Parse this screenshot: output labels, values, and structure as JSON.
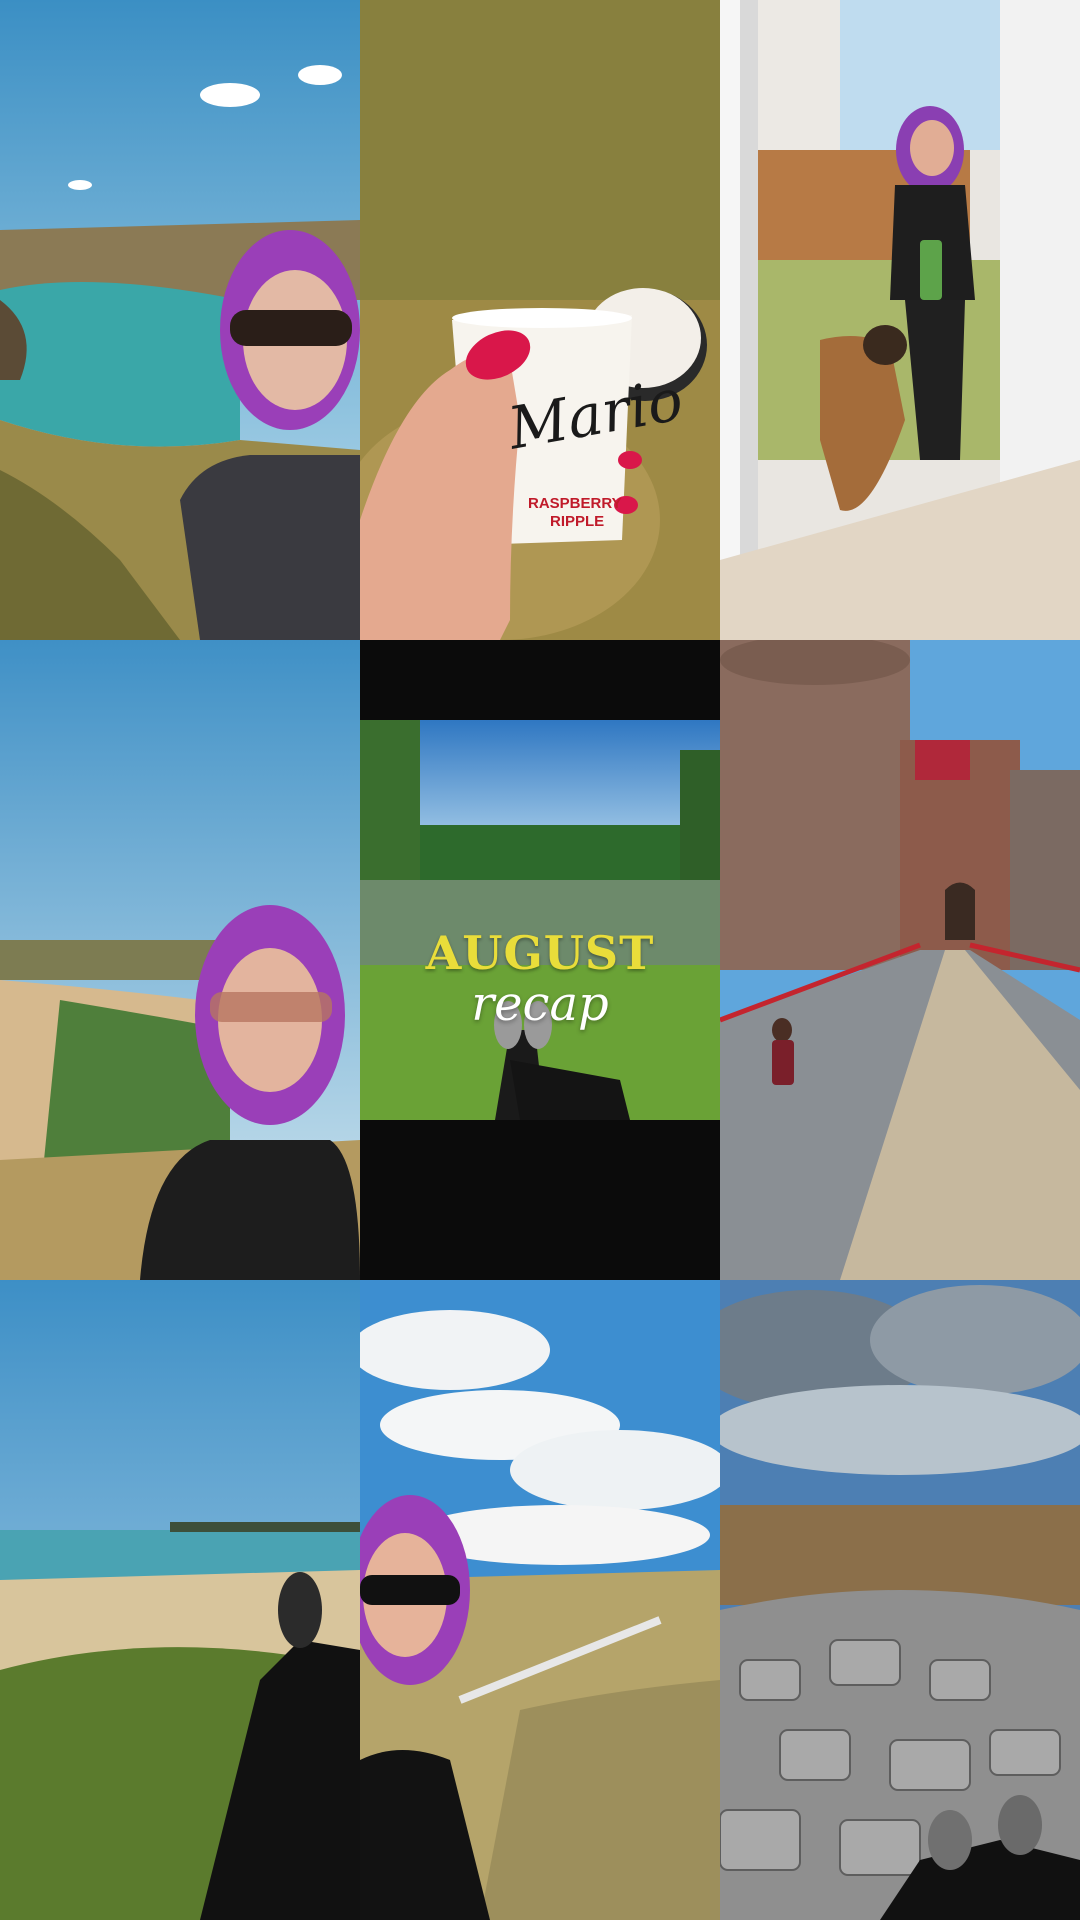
{
  "recap": {
    "title_word1": "AUGUST",
    "title_word2": "recap"
  },
  "icecream": {
    "brand": "Mario",
    "flavour_line1": "RASPBERRY",
    "flavour_line2": "RIPPLE"
  },
  "colors": {
    "title_yellow": "#e9dd3a",
    "hair_purple": "#9a3fb8",
    "sky_blue": "#3e93c9",
    "castle_brick": "#8a5a4a",
    "bridge_red": "#c4252e"
  }
}
